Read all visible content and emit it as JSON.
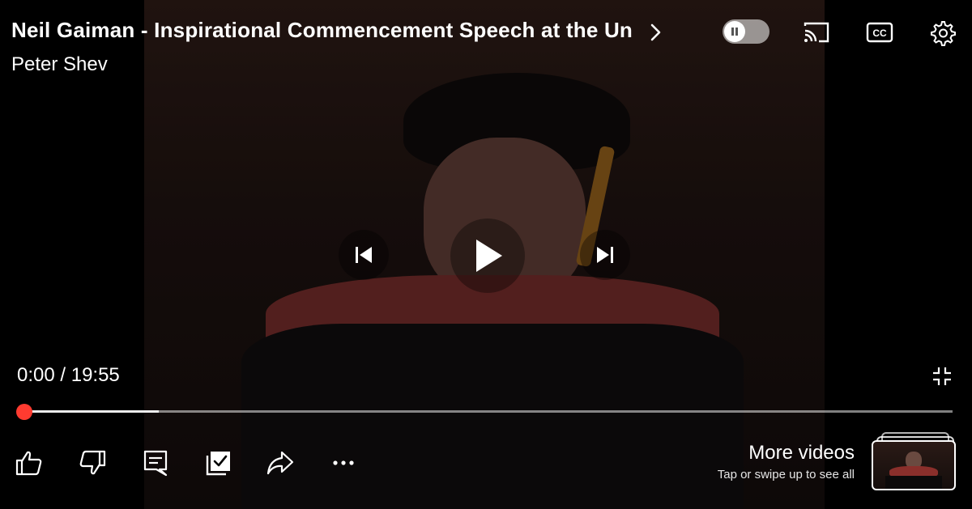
{
  "video": {
    "title": "Neil Gaiman - Inspirational Commencement Speech at the Un",
    "channel": "Peter Shev"
  },
  "playback": {
    "time_display": "0:00 / 19:55",
    "progress_fraction": 0.0,
    "buffered_fraction": 0.145,
    "autoplay_state": "paused-toggle"
  },
  "top_controls": {
    "icons": [
      "chevron-right-icon",
      "autoplay-toggle",
      "cast-icon",
      "captions-icon",
      "settings-icon"
    ],
    "captions_label": "CC"
  },
  "center_controls": {
    "icons": [
      "previous-icon",
      "play-icon",
      "next-icon"
    ]
  },
  "actions": {
    "icons": [
      "like-icon",
      "dislike-icon",
      "comments-icon",
      "save-icon",
      "share-icon",
      "more-icon"
    ]
  },
  "more_videos": {
    "title": "More videos",
    "subtitle": "Tap or swipe up to see all"
  },
  "colors": {
    "accent": "#ff3b30",
    "background": "#000000",
    "text": "#ffffff"
  }
}
